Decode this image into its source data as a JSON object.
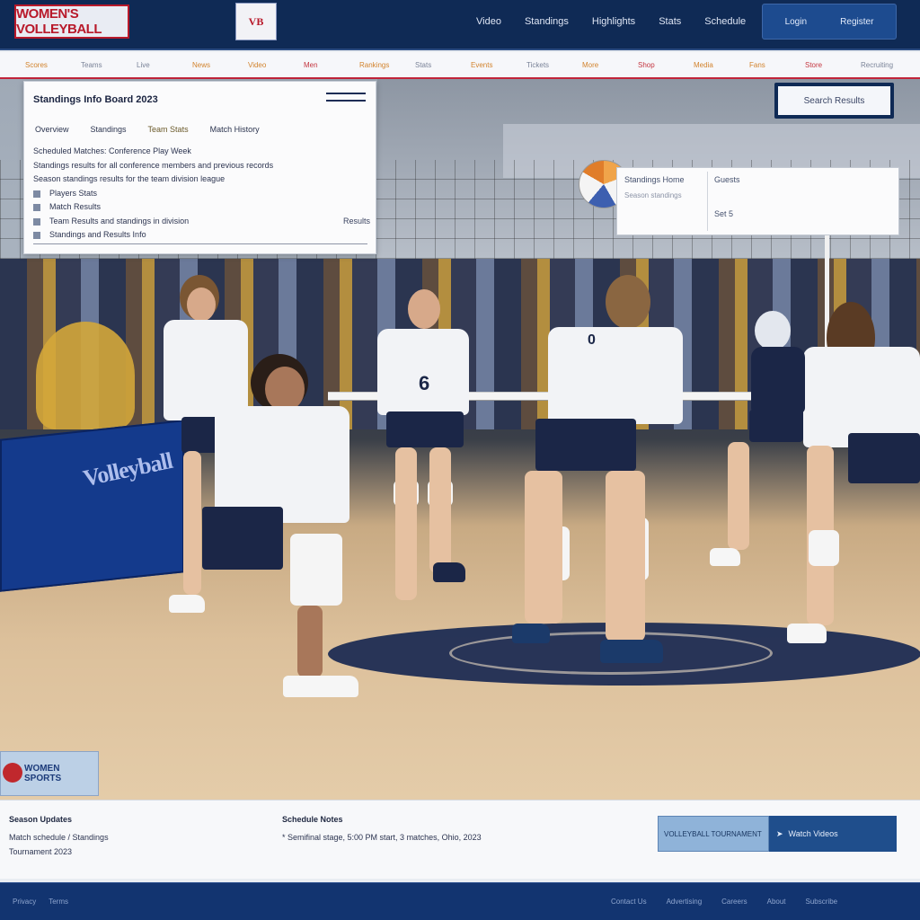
{
  "header": {
    "logo_left": "WOMEN'S VOLLEYBALL",
    "logo_right": "VB",
    "nav": [
      "Video",
      "Standings",
      "Highlights",
      "Stats",
      "Schedule"
    ],
    "buttons": [
      "Login",
      "Register"
    ]
  },
  "subnav": {
    "items": [
      "Scores",
      "Teams",
      "Live",
      "News",
      "Video",
      "Men",
      "Rankings",
      "Stats",
      "Events",
      "Tickets",
      "More",
      "Shop",
      "Media",
      "Fans",
      "Store",
      "Recruiting"
    ]
  },
  "panel": {
    "title": "Standings Info Board 2023",
    "tabs": [
      "Overview",
      "Standings",
      "Team Stats",
      "Match History"
    ],
    "lines": [
      "Scheduled Matches: Conference Play Week",
      "Standings results for all conference members and previous records",
      "Season standings results for the team division league",
      "Players Stats",
      "Match Results",
      "Team Results and standings in division",
      "Standings and Results Info"
    ],
    "line_right": "Results"
  },
  "search": {
    "label": "Search Results"
  },
  "score": {
    "home": "Standings Home",
    "away": "Guests",
    "sub": "Season standings",
    "stat": "Set  5"
  },
  "badge": {
    "label": "WOMEN SPORTS"
  },
  "info": {
    "heading1": "Season Updates",
    "text1": "Match schedule / Standings",
    "text2": "Tournament 2023",
    "heading2": "Schedule Notes",
    "text3": "* Semifinal stage, 5:00 PM start, 3 matches, Ohio, 2023"
  },
  "promo": {
    "left": "VOLLEYBALL TOURNAMENT",
    "right": "Watch Videos"
  },
  "footer": {
    "left": [
      "Privacy",
      "Terms"
    ],
    "right": [
      "Contact Us",
      "Advertising",
      "Careers",
      "About",
      "Subscribe"
    ]
  },
  "colors": {
    "brand_navy": "#0f2a55",
    "accent_red": "#c1243a",
    "panel_bg": "#fbfbfc"
  }
}
